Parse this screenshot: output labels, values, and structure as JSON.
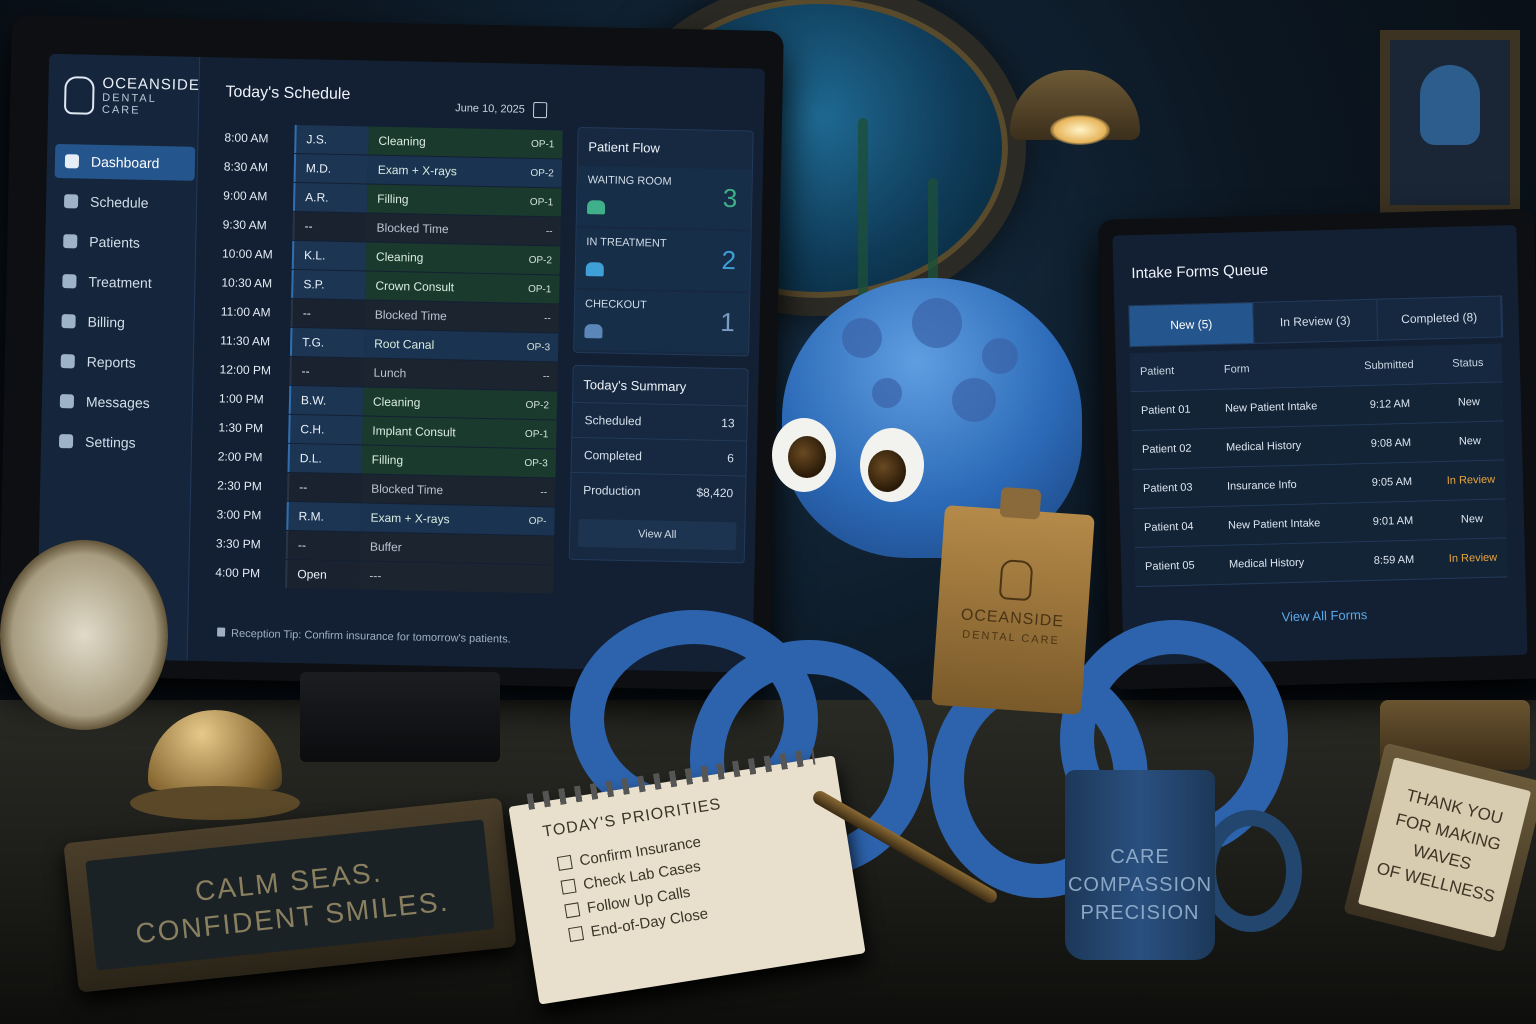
{
  "app": {
    "brand_line1": "OCEANSIDE",
    "brand_line2": "DENTAL CARE"
  },
  "sidebar": {
    "items": [
      {
        "label": "Dashboard",
        "icon": "dashboard-icon",
        "active": true
      },
      {
        "label": "Schedule",
        "icon": "calendar-icon"
      },
      {
        "label": "Patients",
        "icon": "patients-icon"
      },
      {
        "label": "Treatment",
        "icon": "tooth-icon"
      },
      {
        "label": "Billing",
        "icon": "billing-icon"
      },
      {
        "label": "Reports",
        "icon": "reports-icon"
      },
      {
        "label": "Messages",
        "icon": "mail-icon"
      },
      {
        "label": "Settings",
        "icon": "gear-icon"
      }
    ]
  },
  "schedule": {
    "title": "Today's Schedule",
    "date": "June 10, 2025",
    "rows": [
      {
        "time": "8:00 AM",
        "patient": "J.S.",
        "procedure": "Cleaning",
        "op": "OP-1"
      },
      {
        "time": "8:30 AM",
        "patient": "M.D.",
        "procedure": "Exam + X-rays",
        "op": "OP-2"
      },
      {
        "time": "9:00 AM",
        "patient": "A.R.",
        "procedure": "Filling",
        "op": "OP-1"
      },
      {
        "time": "9:30 AM",
        "patient": "--",
        "procedure": "Blocked Time",
        "op": "--"
      },
      {
        "time": "10:00 AM",
        "patient": "K.L.",
        "procedure": "Cleaning",
        "op": "OP-2"
      },
      {
        "time": "10:30 AM",
        "patient": "S.P.",
        "procedure": "Crown Consult",
        "op": "OP-1"
      },
      {
        "time": "11:00 AM",
        "patient": "--",
        "procedure": "Blocked Time",
        "op": "--"
      },
      {
        "time": "11:30 AM",
        "patient": "T.G.",
        "procedure": "Root Canal",
        "op": "OP-3"
      },
      {
        "time": "12:00 PM",
        "patient": "--",
        "procedure": "Lunch",
        "op": "--"
      },
      {
        "time": "1:00 PM",
        "patient": "B.W.",
        "procedure": "Cleaning",
        "op": "OP-2"
      },
      {
        "time": "1:30 PM",
        "patient": "C.H.",
        "procedure": "Implant Consult",
        "op": "OP-1"
      },
      {
        "time": "2:00 PM",
        "patient": "D.L.",
        "procedure": "Filling",
        "op": "OP-3"
      },
      {
        "time": "2:30 PM",
        "patient": "--",
        "procedure": "Blocked Time",
        "op": "--"
      },
      {
        "time": "3:00 PM",
        "patient": "R.M.",
        "procedure": "Exam + X-rays",
        "op": "OP-"
      },
      {
        "time": "3:30 PM",
        "patient": "--",
        "procedure": "Buffer",
        "op": ""
      },
      {
        "time": "4:00 PM",
        "patient": "Open",
        "procedure": "---",
        "op": ""
      }
    ],
    "tip": "Reception Tip: Confirm insurance for tomorrow's patients."
  },
  "flow": {
    "title": "Patient Flow",
    "cards": [
      {
        "label": "WAITING ROOM",
        "count": "3"
      },
      {
        "label": "IN TREATMENT",
        "count": "2"
      },
      {
        "label": "CHECKOUT",
        "count": "1"
      }
    ],
    "summary_title": "Today's Summary",
    "summary": [
      {
        "label": "Scheduled",
        "value": "13"
      },
      {
        "label": "Completed",
        "value": "6"
      },
      {
        "label": "Production",
        "value": "$8,420"
      }
    ],
    "view_all": "View All"
  },
  "intake": {
    "title": "Intake Forms Queue",
    "tabs": [
      "New (5)",
      "In Review (3)",
      "Completed (8)"
    ],
    "columns": [
      "Patient",
      "Form",
      "Submitted",
      "Status"
    ],
    "rows": [
      {
        "patient": "Patient 01",
        "form": "New Patient Intake",
        "submitted": "9:12 AM",
        "status": "New"
      },
      {
        "patient": "Patient 02",
        "form": "Medical History",
        "submitted": "9:08 AM",
        "status": "New"
      },
      {
        "patient": "Patient 03",
        "form": "Insurance Info",
        "submitted": "9:05 AM",
        "status": "In Review"
      },
      {
        "patient": "Patient 04",
        "form": "New Patient Intake",
        "submitted": "9:01 AM",
        "status": "New"
      },
      {
        "patient": "Patient 05",
        "form": "Medical History",
        "submitted": "8:59 AM",
        "status": "In Review"
      }
    ],
    "view_all": "View All Forms"
  },
  "clipboard": {
    "line1": "OCEANSIDE",
    "line2": "DENTAL CARE"
  },
  "plaque": {
    "line1": "CALM SEAS.",
    "line2": "CONFIDENT SMILES."
  },
  "notepad": {
    "title": "TODAY'S PRIORITIES",
    "items": [
      "Confirm Insurance",
      "Check Lab Cases",
      "Follow Up Calls",
      "End-of-Day Close"
    ]
  },
  "mug": {
    "line1": "CARE",
    "line2": "COMPASSION",
    "line3": "PRECISION"
  },
  "thanks_sign": {
    "line1": "THANK YOU",
    "line2": "FOR MAKING",
    "line3": "WAVES",
    "line4": "OF WELLNESS"
  },
  "colors": {
    "accent": "#24558c",
    "review": "#e6a43c",
    "flow_number": "#3fa0d8"
  }
}
